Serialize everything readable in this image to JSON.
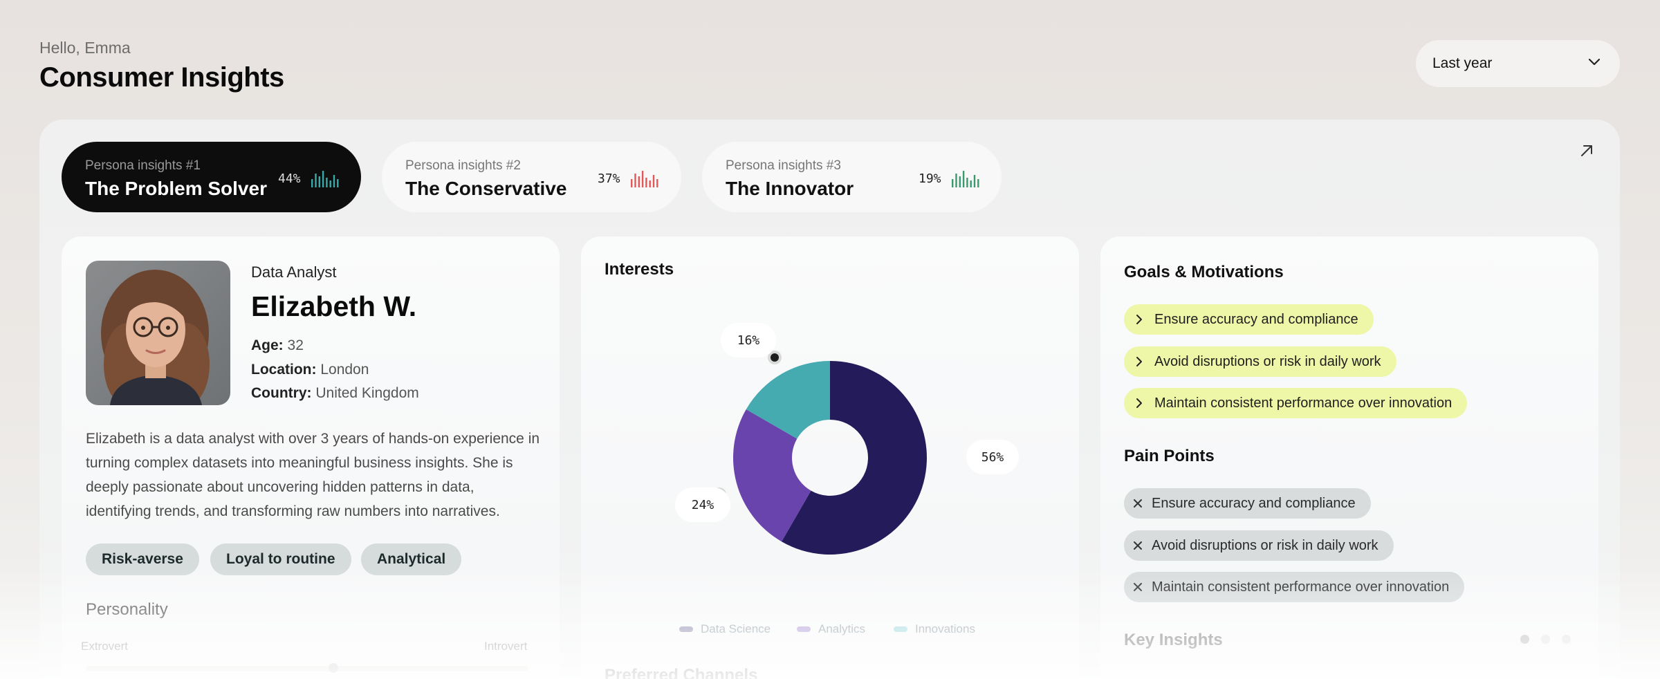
{
  "header": {
    "greeting": "Hello, Emma",
    "title": "Consumer Insights"
  },
  "period_select": {
    "value": "Last year"
  },
  "persona_tabs": [
    {
      "label": "Persona insights #1",
      "name": "The Problem Solver",
      "percent": "44%",
      "bar_color": "#3ca9a8",
      "active": true
    },
    {
      "label": "Persona insights #2",
      "name": "The Conservative",
      "percent": "37%",
      "bar_color": "#e25757",
      "active": false
    },
    {
      "label": "Persona insights #3",
      "name": "The Innovator",
      "percent": "19%",
      "bar_color": "#3a9a6e",
      "active": false
    }
  ],
  "profile": {
    "role": "Data Analyst",
    "name": "Elizabeth W.",
    "age_label": "Age:",
    "age": "32",
    "location_label": "Location:",
    "location": "London",
    "country_label": "Country:",
    "country": "United Kingdom",
    "bio": "Elizabeth is a data analyst with over 3 years of hands-on experience in turning complex datasets into meaningful business insights. She is deeply passionate about uncovering hidden patterns in data, identifying trends, and transforming raw numbers into narratives.",
    "traits": [
      "Risk-averse",
      "Loyal to routine",
      "Analytical"
    ],
    "personality_title": "Personality",
    "scale_left": "Extrovert",
    "scale_right": "Introvert",
    "personality_value": 0.56
  },
  "interests": {
    "title": "Interests",
    "next_title": "Preferred Channels",
    "chart_data": {
      "type": "pie",
      "categories": [
        "Data Science",
        "Analytics",
        "Innovations"
      ],
      "values": [
        56,
        24,
        16
      ],
      "labels": [
        "56%",
        "24%",
        "16%"
      ],
      "colors": [
        "#241c5a",
        "#6a44ad",
        "#45abb0"
      ],
      "legend_colors": [
        "#9b96b4",
        "#b9a6dc",
        "#a8dde0"
      ],
      "legend": "bottom"
    }
  },
  "goals": {
    "title": "Goals & Motivations",
    "items": [
      "Ensure accuracy and compliance",
      "Avoid disruptions or risk in daily work",
      "Maintain consistent performance over innovation"
    ]
  },
  "pain_points": {
    "title": "Pain Points",
    "items": [
      "Ensure accuracy and compliance",
      "Avoid disruptions or risk in daily work",
      "Maintain consistent performance over innovation"
    ]
  },
  "key_insights": {
    "title": "Key Insights",
    "page": 1,
    "pages": 3
  },
  "icons": {
    "period": "chevron-down-icon",
    "expand": "arrow-up-right-icon",
    "goal": "chevron-right-icon",
    "pain": "close-icon"
  }
}
